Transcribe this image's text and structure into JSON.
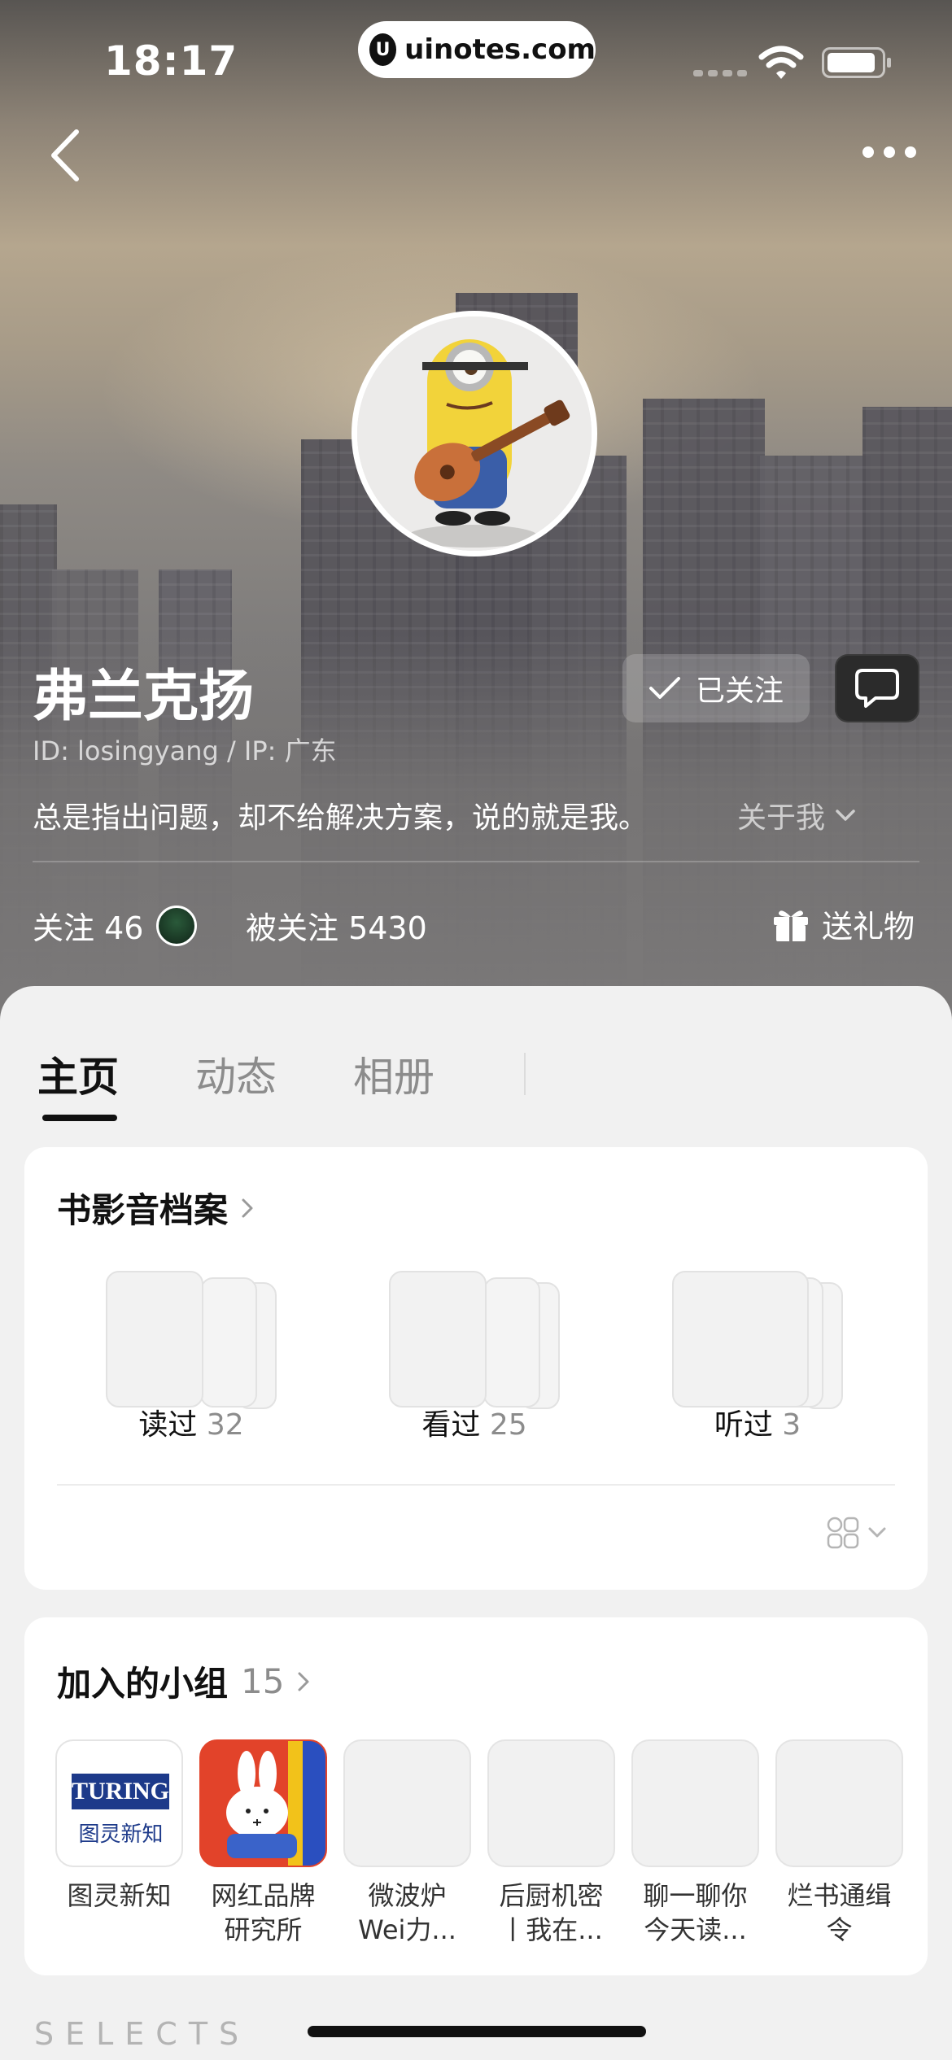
{
  "status_bar": {
    "time": "18:17",
    "url": "uinotes.com",
    "logo_letter": "U"
  },
  "nav": {
    "back_icon": "chevron-left-icon",
    "more_icon": "ellipsis-icon"
  },
  "profile": {
    "name": "弗兰克扬",
    "id_ip": "ID: losingyang / IP: 广东",
    "follow_label": "已关注",
    "bio": "总是指出问题，却不给解决方案，说的就是我。",
    "about_label": "关于我",
    "following_label": "关注 46",
    "followers_label": "被关注 5430",
    "gift_label": "送礼物"
  },
  "tabs": [
    {
      "label": "主页",
      "active": true
    },
    {
      "label": "动态",
      "active": false
    },
    {
      "label": "相册",
      "active": false
    }
  ],
  "archive": {
    "title": "书影音档案",
    "items": [
      {
        "label": "读过",
        "count": "32"
      },
      {
        "label": "看过",
        "count": "25"
      },
      {
        "label": "听过",
        "count": "3"
      }
    ]
  },
  "groups": {
    "title": "加入的小组",
    "count": "15",
    "items": [
      {
        "name": "图灵新知",
        "logo_text": "TURING",
        "logo_sub": "图灵新知"
      },
      {
        "name": "网红品牌\n研究所"
      },
      {
        "name": "微波炉\nWei力..."
      },
      {
        "name": "后厨机密\n丨我在..."
      },
      {
        "name": "聊一聊你\n今天读..."
      },
      {
        "name": "烂书通缉\n令"
      }
    ]
  },
  "footer": {
    "selects": "SELECTS"
  },
  "colors": {
    "accent": "#111111",
    "muted": "#8c8c8c",
    "card": "#ffffff",
    "background": "#f1f1f1"
  }
}
